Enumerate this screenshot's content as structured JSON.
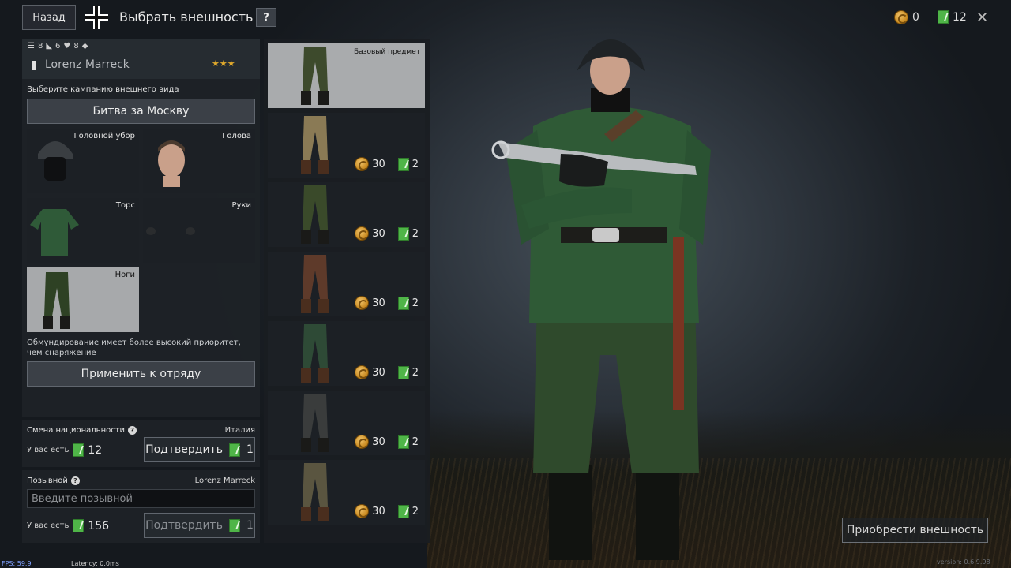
{
  "topbar": {
    "back_label": "Назад",
    "title": "Выбрать внешность",
    "help_label": "?",
    "gold": "0",
    "tickets": "12",
    "close_label": "✕"
  },
  "soldier": {
    "stat1": "8",
    "stat2": "6",
    "stat3": "8",
    "name": "Lorenz Marreck",
    "stars": "★★★"
  },
  "campaign": {
    "label": "Выберите кампанию внешнего вида",
    "value": "Битва за Москву"
  },
  "slots": {
    "head_gear": "Головной убор",
    "head": "Голова",
    "torso": "Торс",
    "hands": "Руки",
    "legs": "Ноги"
  },
  "priority_note": "Обмундирование имеет более высокий приоритет, чем снаряжение",
  "apply_label": "Применить к отряду",
  "nationality": {
    "title": "Смена национальности",
    "value": "Италия",
    "have_label": "У вас есть",
    "have_count": "12",
    "confirm_label": "Подтвердить",
    "cost": "1"
  },
  "callsign": {
    "title": "Позывной",
    "value": "Lorenz Marreck",
    "placeholder": "Введите позывной",
    "have_label": "У вас есть",
    "have_count": "156",
    "confirm_label": "Подтвердить",
    "cost": "1"
  },
  "items": [
    {
      "label": "Базовый предмет",
      "gold": "",
      "tickets": "",
      "color": "#3d4a2c"
    },
    {
      "label": "",
      "gold": "30",
      "tickets": "2",
      "color": "#8a7a55"
    },
    {
      "label": "",
      "gold": "30",
      "tickets": "2",
      "color": "#3a4a2a"
    },
    {
      "label": "",
      "gold": "30",
      "tickets": "2",
      "color": "#5e3a2a"
    },
    {
      "label": "",
      "gold": "30",
      "tickets": "2",
      "color": "#2e4a36"
    },
    {
      "label": "",
      "gold": "30",
      "tickets": "2",
      "color": "#3a3c3c"
    },
    {
      "label": "",
      "gold": "30",
      "tickets": "2",
      "color": "#5a5540"
    }
  ],
  "buy_label": "Приобрести внешность",
  "debug": {
    "fps": "FPS: 59.9",
    "latency": "Latency:   0.0ms",
    "version": "version: 0.6.9.98"
  }
}
